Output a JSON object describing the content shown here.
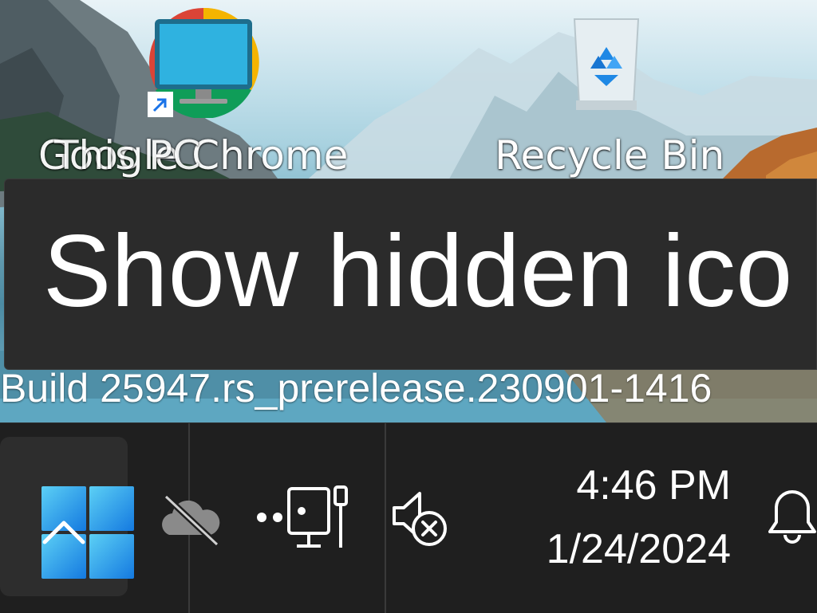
{
  "desktop": {
    "icons": [
      {
        "label": "Google Chrome",
        "icon": "chrome-icon"
      },
      {
        "label": "This PC",
        "icon": "monitor-icon"
      },
      {
        "label": "Recycle Bin",
        "icon": "recycle-bin-icon"
      }
    ],
    "watermark": "Build 25947.rs_prerelease.230901-1416"
  },
  "tooltip": {
    "text": "Show hidden ico"
  },
  "taskbar": {
    "start_icon": "windows-logo-icon",
    "tray": {
      "chevron_icon": "chevron-up-icon",
      "onedrive_icon": "onedrive-offline-icon",
      "network_icon": "network-ethernet-icon",
      "volume_icon": "volume-muted-icon"
    },
    "clock": {
      "time": "4:46 PM",
      "date": "1/24/2024"
    },
    "notifications_icon": "bell-icon"
  },
  "colors": {
    "taskbar": "#1f1f1f",
    "tooltip": "#2b2b2b",
    "accent": "#3aa0e8"
  }
}
